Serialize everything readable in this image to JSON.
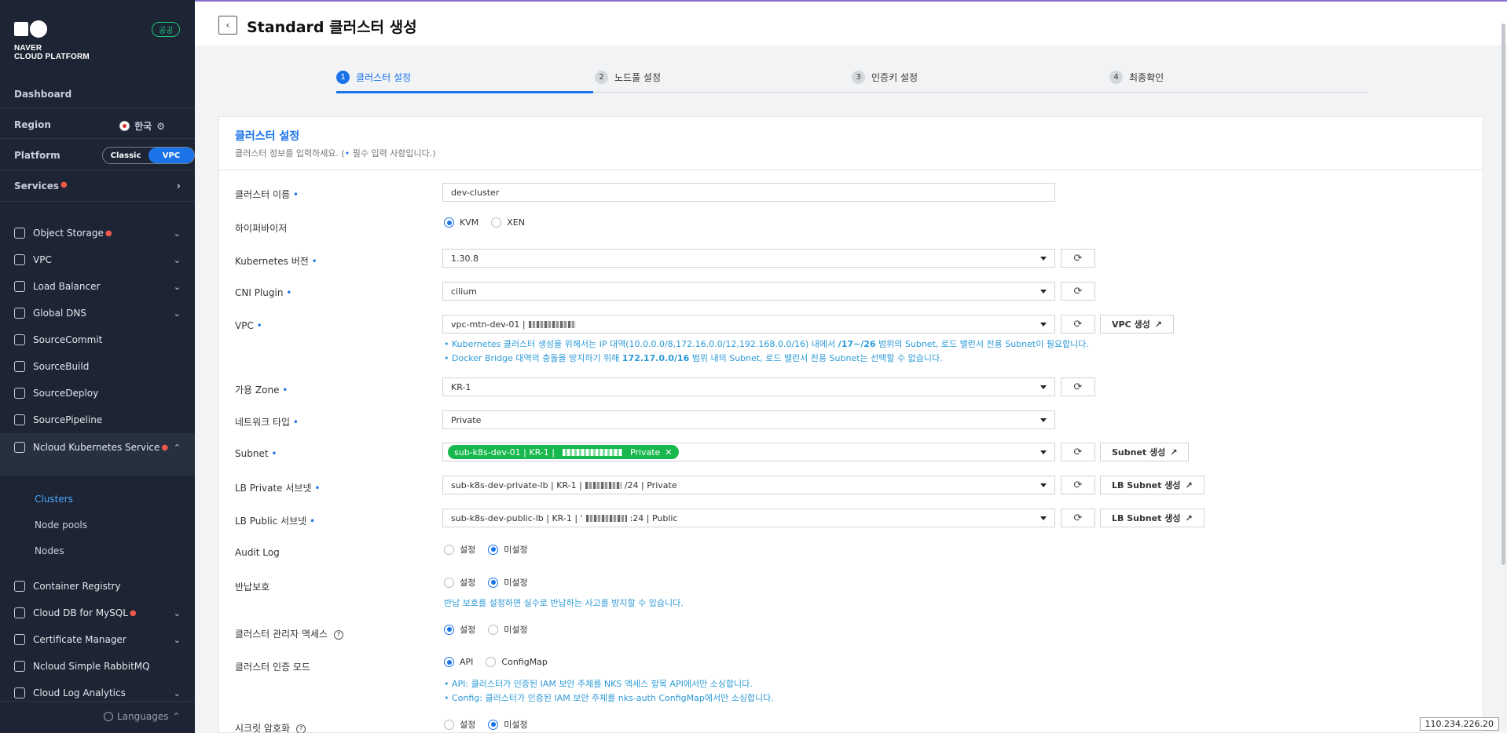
{
  "sidebar": {
    "logo_line1": "NAVER",
    "logo_line2": "CLOUD PLATFORM",
    "gov_badge": "공공",
    "dashboard": "Dashboard",
    "region_label": "Region",
    "region_value": "한국",
    "platform_label": "Platform",
    "platform_classic": "Classic",
    "platform_vpc": "VPC",
    "services_label": "Services",
    "menu": [
      {
        "label": "Object Storage",
        "icon": "object-storage-icon",
        "new": true,
        "expandable": true
      },
      {
        "label": "VPC",
        "icon": "vpc-icon",
        "new": false,
        "expandable": true
      },
      {
        "label": "Load Balancer",
        "icon": "load-balancer-icon",
        "new": false,
        "expandable": true
      },
      {
        "label": "Global DNS",
        "icon": "dns-icon",
        "new": false,
        "expandable": true
      },
      {
        "label": "SourceCommit",
        "icon": "source-commit-icon",
        "new": false,
        "expandable": false
      },
      {
        "label": "SourceBuild",
        "icon": "source-build-icon",
        "new": false,
        "expandable": false
      },
      {
        "label": "SourceDeploy",
        "icon": "source-deploy-icon",
        "new": false,
        "expandable": false
      },
      {
        "label": "SourcePipeline",
        "icon": "source-pipeline-icon",
        "new": false,
        "expandable": false
      },
      {
        "label": "Ncloud Kubernetes Service",
        "icon": "kubernetes-icon",
        "new": true,
        "expandable": true
      },
      {
        "label": "Container Registry",
        "icon": "container-registry-icon",
        "new": false,
        "expandable": false
      },
      {
        "label": "Cloud DB for MySQL",
        "icon": "database-icon",
        "new": true,
        "expandable": true
      },
      {
        "label": "Certificate Manager",
        "icon": "certificate-icon",
        "new": false,
        "expandable": true
      },
      {
        "label": "Ncloud Simple RabbitMQ",
        "icon": "rabbitmq-icon",
        "new": false,
        "expandable": false
      },
      {
        "label": "Cloud Log Analytics",
        "icon": "log-analytics-icon",
        "new": false,
        "expandable": true
      }
    ],
    "sub_items": [
      "Clusters",
      "Node pools",
      "Nodes"
    ],
    "languages": "Languages"
  },
  "header": {
    "title": "Standard 클러스터 생성"
  },
  "steps": [
    {
      "num": "1",
      "label": "클러스터 설정"
    },
    {
      "num": "2",
      "label": "노드풀 설정"
    },
    {
      "num": "3",
      "label": "인증키 설정"
    },
    {
      "num": "4",
      "label": "최종확인"
    }
  ],
  "card": {
    "title": "클러스터 설정",
    "desc_prefix": "클러스터 정보를 입력하세요. (",
    "desc_suffix": " 필수 입력 사항입니다.)"
  },
  "form": {
    "cluster_name": {
      "label": "클러스터 이름",
      "value": "dev-cluster"
    },
    "hypervisor": {
      "label": "하이퍼바이저",
      "opt1": "KVM",
      "opt2": "XEN"
    },
    "k8s_version": {
      "label": "Kubernetes 버전",
      "value": "1.30.8"
    },
    "cni": {
      "label": "CNI Plugin",
      "value": "cilium"
    },
    "vpc": {
      "label": "VPC",
      "value": "vpc-mtn-dev-01 |",
      "create_btn": "VPC 생성",
      "hint1_a": "Kubernetes 클러스터 생성을 위해서는 IP 대역(10.0.0.0/8,172.16.0.0/12,192.168.0.0/16) 내에서 ",
      "hint1_b": "/17~/26",
      "hint1_c": " 범위의 Subnet, 로드 밸런서 전용 Subnet이 필요합니다.",
      "hint2_a": "Docker Bridge 대역의 충돌을 방지하기 위해 ",
      "hint2_b": "172.17.0.0/16",
      "hint2_c": " 범위 내의 Subnet, 로드 밸런서 전용 Subnet는 선택할 수 없습니다."
    },
    "zone": {
      "label": "가용 Zone",
      "value": "KR-1"
    },
    "network_type": {
      "label": "네트워크 타입",
      "value": "Private"
    },
    "subnet": {
      "label": "Subnet",
      "chip_a": "sub-k8s-dev-01 | KR-1 |",
      "chip_b": "Private",
      "create_btn": "Subnet 생성"
    },
    "lb_private": {
      "label": "LB Private 서브넷",
      "value_a": "sub-k8s-dev-private-lb | KR-1 |",
      "value_b": "/24 | Private",
      "create_btn": "LB Subnet 생성"
    },
    "lb_public": {
      "label": "LB Public 서브넷",
      "value_a": "sub-k8s-dev-public-lb | KR-1 | '",
      "value_b": ":24 | Public",
      "create_btn": "LB Subnet 생성"
    },
    "audit_log": {
      "label": "Audit Log",
      "opt1": "설정",
      "opt2": "미설정"
    },
    "return_protect": {
      "label": "반납보호",
      "opt1": "설정",
      "opt2": "미설정",
      "hint": "반납 보호를 설정하면 실수로 반납하는 사고를 방지할 수 있습니다."
    },
    "admin_access": {
      "label": "클러스터 관리자 액세스",
      "opt1": "설정",
      "opt2": "미설정"
    },
    "auth_mode": {
      "label": "클러스터 인증 모드",
      "opt1": "API",
      "opt2": "ConfigMap",
      "hint1": "API: 클러스터가 인증된 IAM 보안 주체를 NKS 액세스 항목 API에서만 소싱합니다.",
      "hint2": "Config: 클러스터가 인증된 IAM 보안 주체를 nks-auth ConfigMap에서만 소싱합니다."
    },
    "secret_encrypt": {
      "label": "시크릿 암호화",
      "opt1": "설정",
      "opt2": "미설정"
    }
  },
  "ip_label": "110.234.226.20",
  "colors": {
    "accent": "#1a73e8",
    "sidebar_bg": "#1d2433",
    "chip": "#17b84d",
    "hint": "#2d9ad8"
  }
}
